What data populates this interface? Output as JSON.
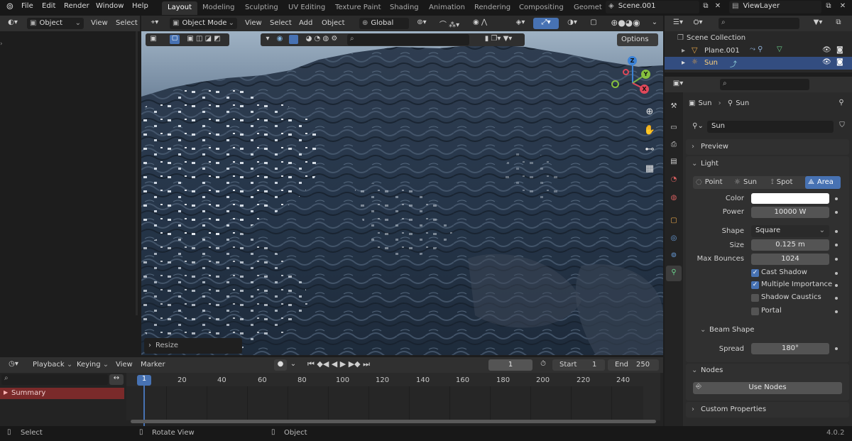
{
  "menubar": {
    "items": [
      "File",
      "Edit",
      "Render",
      "Window",
      "Help"
    ],
    "workspaces": [
      "Layout",
      "Modeling",
      "Sculpting",
      "UV Editing",
      "Texture Paint",
      "Shading",
      "Animation",
      "Rendering",
      "Compositing",
      "Geomet"
    ],
    "scene": "Scene.001",
    "view_layer": "ViewLayer"
  },
  "left_header": {
    "mode": "Object",
    "view": "View",
    "select": "Select"
  },
  "viewport_header": {
    "mode": "Object Mode",
    "menus": [
      "View",
      "Select",
      "Add",
      "Object"
    ],
    "orientation": "Global",
    "options": "Options"
  },
  "viewport": {
    "resize_label": "Resize"
  },
  "gizmo": {
    "x": "X",
    "y": "Y",
    "z": "Z"
  },
  "outliner": {
    "title": "Scene Collection",
    "items": [
      {
        "name": "Plane.001",
        "icon": "triangle-mesh-icon"
      },
      {
        "name": "Sun",
        "icon": "sun-light-icon"
      }
    ]
  },
  "properties": {
    "breadcrumb": {
      "object": "Sun",
      "data": "Sun"
    },
    "datablock_name": "Sun",
    "panels": {
      "preview": "Preview",
      "light": "Light",
      "beam_shape": "Beam Shape",
      "nodes": "Nodes",
      "custom_properties": "Custom Properties"
    },
    "light_types": [
      "Point",
      "Sun",
      "Spot",
      "Area"
    ],
    "active_light_type": "Area",
    "fields": {
      "color_label": "Color",
      "power_label": "Power",
      "power": "10000 W",
      "shape_label": "Shape",
      "shape": "Square",
      "size_label": "Size",
      "size": "0.125 m",
      "max_bounces_label": "Max Bounces",
      "max_bounces": "1024",
      "spread_label": "Spread",
      "spread": "180°"
    },
    "checkboxes": [
      {
        "label": "Cast Shadow",
        "checked": true
      },
      {
        "label": "Multiple Importance",
        "checked": true
      },
      {
        "label": "Shadow Caustics",
        "checked": false
      },
      {
        "label": "Portal",
        "checked": false
      }
    ],
    "use_nodes": "Use Nodes",
    "light_color": "#ffffff"
  },
  "timeline": {
    "menus": [
      "Playback",
      "Keying",
      "View",
      "Marker"
    ],
    "current_frame": "1",
    "start_label": "Start",
    "start": "1",
    "end_label": "End",
    "end": "250",
    "ticks": [
      "1",
      "20",
      "40",
      "60",
      "80",
      "100",
      "120",
      "140",
      "160",
      "180",
      "200",
      "220",
      "240"
    ],
    "summary": "Summary"
  },
  "statusbar": {
    "select": "Select",
    "rotate": "Rotate View",
    "object": "Object",
    "version": "4.0.2"
  },
  "colors": {
    "accent": "#4772b3",
    "active_row": "#334d80",
    "summary_bg": "#7a2a2a",
    "playhead": "#4772b3"
  }
}
